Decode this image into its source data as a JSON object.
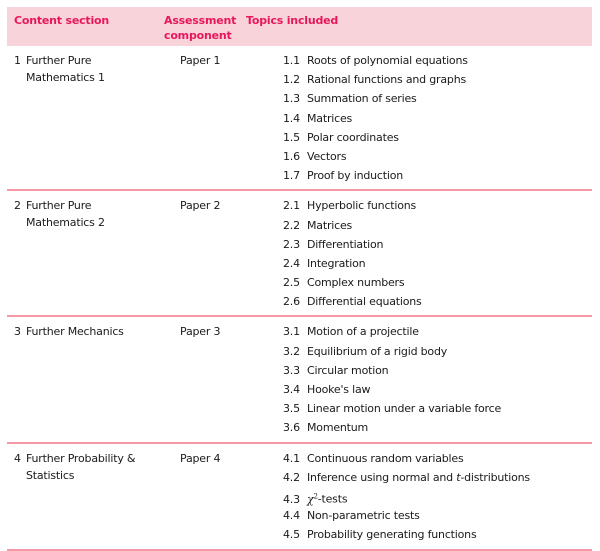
{
  "header": {
    "col1": "Content section",
    "col2": "Assessment component",
    "col3": "Topics included"
  },
  "colors": {
    "header_bg": "#f9d3da",
    "header_text": "#e8175d",
    "rule": "#f497a6"
  },
  "sections": [
    {
      "number": "1",
      "title": "Further Pure Mathematics 1",
      "paper": "Paper 1",
      "topics": [
        {
          "num": "1.1",
          "label": "Roots of polynomial equations"
        },
        {
          "num": "1.2",
          "label": "Rational functions and graphs"
        },
        {
          "num": "1.3",
          "label": "Summation of series"
        },
        {
          "num": "1.4",
          "label": "Matrices"
        },
        {
          "num": "1.5",
          "label": "Polar coordinates"
        },
        {
          "num": "1.6",
          "label": "Vectors"
        },
        {
          "num": "1.7",
          "label": "Proof by induction"
        }
      ]
    },
    {
      "number": "2",
      "title": "Further Pure Mathematics 2",
      "paper": "Paper 2",
      "topics": [
        {
          "num": "2.1",
          "label": "Hyperbolic functions"
        },
        {
          "num": "2.2",
          "label": "Matrices"
        },
        {
          "num": "2.3",
          "label": "Differentiation"
        },
        {
          "num": "2.4",
          "label": "Integration"
        },
        {
          "num": "2.5",
          "label": "Complex numbers"
        },
        {
          "num": "2.6",
          "label": "Differential equations"
        }
      ]
    },
    {
      "number": "3",
      "title": "Further Mechanics",
      "paper": "Paper 3",
      "topics": [
        {
          "num": "3.1",
          "label": "Motion of a projectile"
        },
        {
          "num": "3.2",
          "label": "Equilibrium of a rigid body"
        },
        {
          "num": "3.3",
          "label": "Circular motion"
        },
        {
          "num": "3.4",
          "label": "Hooke's law"
        },
        {
          "num": "3.5",
          "label": "Linear motion under a variable force"
        },
        {
          "num": "3.6",
          "label": "Momentum"
        }
      ]
    },
    {
      "number": "4",
      "title": "Further Probability & Statistics",
      "paper": "Paper 4",
      "topics": [
        {
          "num": "4.1",
          "label": "Continuous random variables"
        },
        {
          "num": "4.2",
          "label_pre": "Inference using normal and ",
          "label_italic": "t",
          "label_post": "-distributions"
        },
        {
          "num": "4.3",
          "symbol": "χ",
          "superscript": "2",
          "label": "-tests"
        },
        {
          "num": "4.4",
          "label": "Non-parametric tests"
        },
        {
          "num": "4.5",
          "label": "Probability generating functions"
        }
      ]
    }
  ]
}
